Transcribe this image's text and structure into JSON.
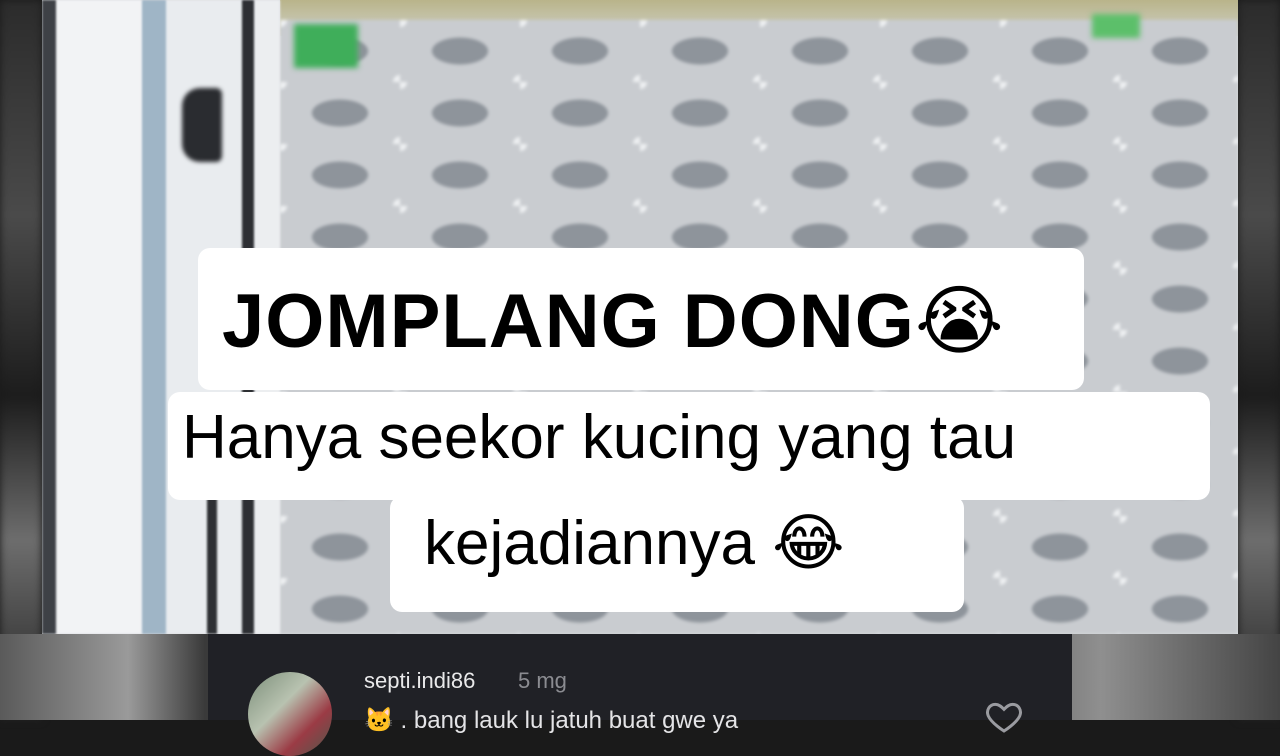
{
  "caption": {
    "line1": "JOMPLANG DONG",
    "line1_emoji": "😭",
    "line2": "Hanya seekor kucing yang tau",
    "line3": "kejadiannya",
    "line3_emoji": "😂"
  },
  "comment": {
    "username": "septi.indi86",
    "time": "5 mg",
    "text_partial": "🐱 . bang lauk lu jatuh buat gwe ya",
    "like_icon": "heart-outline-icon"
  },
  "colors": {
    "bubble": "#ffffff",
    "panel": "#202126"
  }
}
